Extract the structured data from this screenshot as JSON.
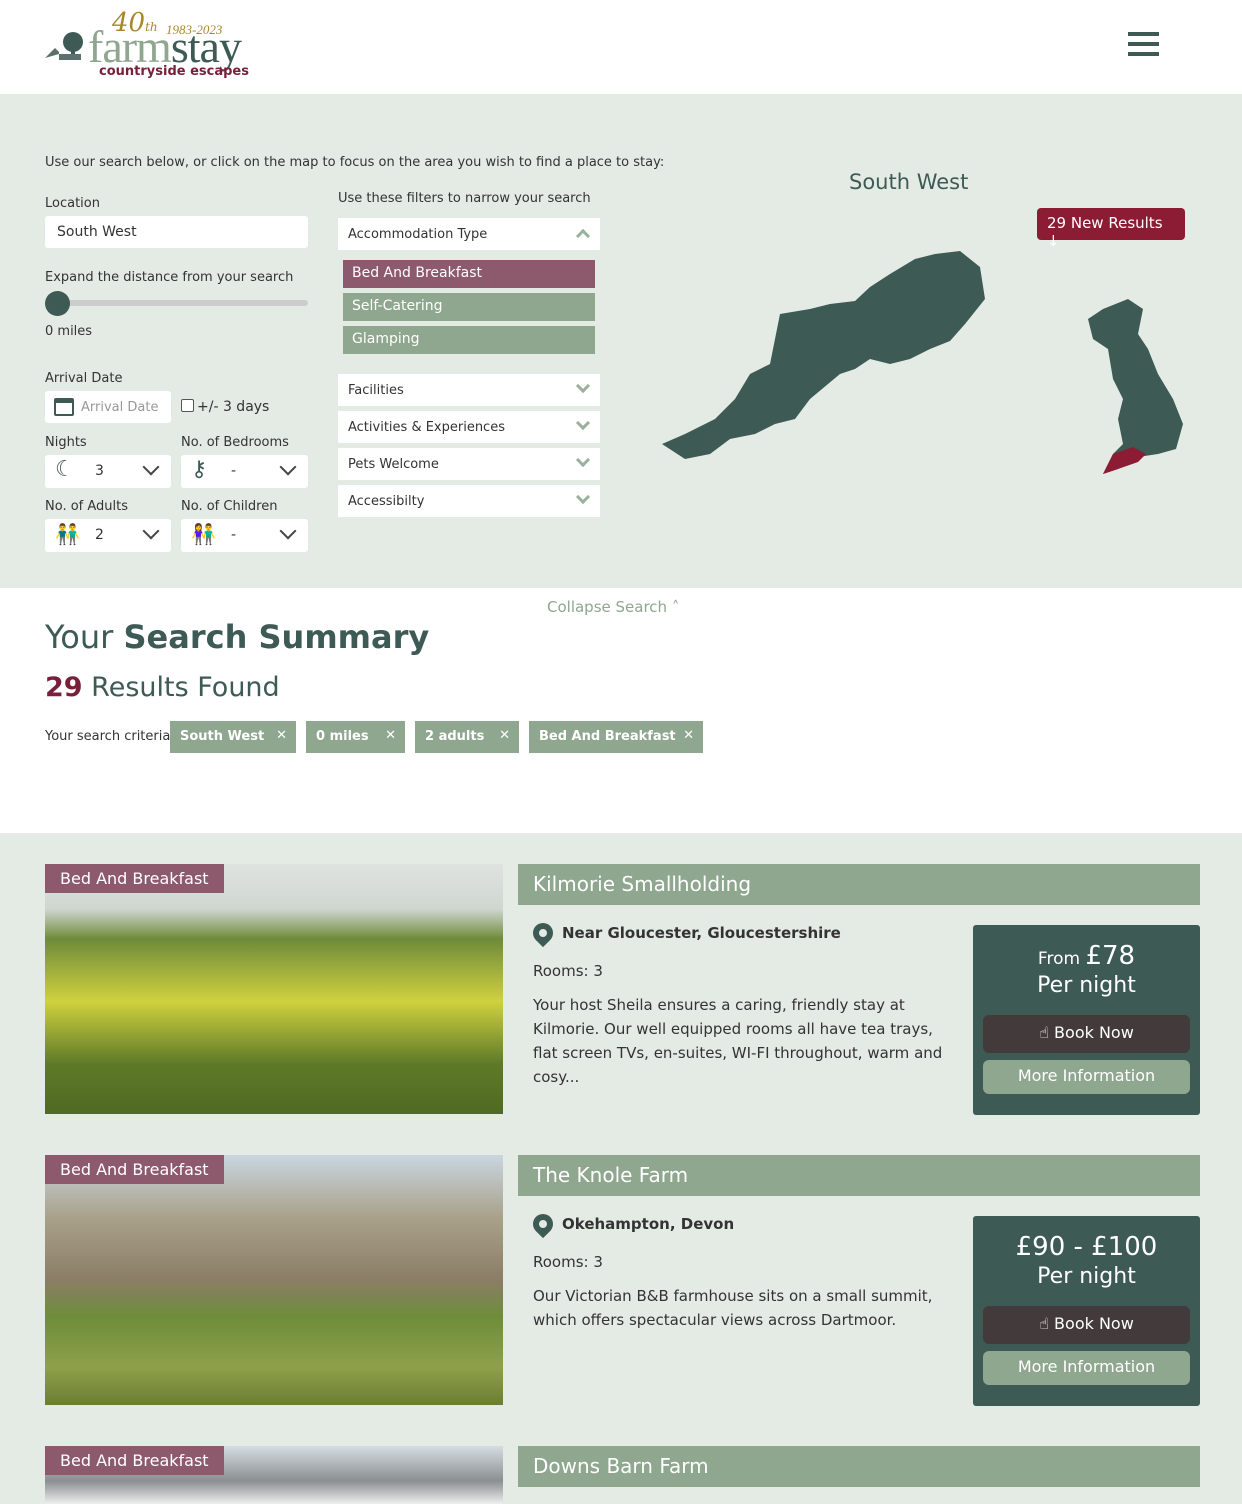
{
  "header": {
    "logo": {
      "anniv": "40",
      "anniv_suffix": "th",
      "years": "1983-2023",
      "name_a": "farm",
      "name_b": "stay",
      "tagline": "countryside escapes"
    },
    "menu_icon": "hamburger-icon"
  },
  "search": {
    "intro": "Use our search below, or click on the map to focus on the area you wish to find a place to stay:",
    "location_label": "Location",
    "location_value": "South West",
    "distance_label": "Expand the distance from your search",
    "distance_value": "0 miles",
    "distance_fraction": 0,
    "arrival_label": "Arrival Date",
    "arrival_placeholder": "Arrival Date",
    "flex_label": "+/- 3 days",
    "flex_checked": false,
    "nights_label": "Nights",
    "nights_value": "3",
    "bedrooms_label": "No. of Bedrooms",
    "bedrooms_value": "-",
    "adults_label": "No. of Adults",
    "adults_value": "2",
    "children_label": "No. of Children",
    "children_value": "-",
    "filters_label": "Use these filters to narrow your search",
    "accommodation_label": "Accommodation Type",
    "accommodation_options": [
      "Bed And Breakfast",
      "Self-Catering",
      "Glamping"
    ],
    "selected_option": "Bed And Breakfast",
    "filters": [
      "Facilities",
      "Activities & Experiences",
      "Pets Welcome",
      "Accessibilty"
    ],
    "new_results": "29 New Results ↓",
    "map_title": "South West",
    "collapse": "Collapse Search"
  },
  "summary": {
    "title_a": "Your ",
    "title_b": "Search Summary",
    "count": "29",
    "count_label": " Results Found",
    "criteria_label": "Your search criteria:",
    "criteria": [
      "South West",
      "0 miles",
      "2 adults",
      "Bed And Breakfast"
    ]
  },
  "colors": {
    "primary": "#3d5a55",
    "accent": "#8c1b34",
    "sage": "#8fa68f",
    "bg": "#e4ebe5"
  },
  "results": [
    {
      "type": "Bed And Breakfast",
      "name": "Kilmorie Smallholding",
      "location": "Near Gloucester, Gloucestershire",
      "rooms": "Rooms: 3",
      "desc": "Your host Sheila ensures a caring, friendly stay at Kilmorie. Our well equipped rooms all have tea trays, flat screen TVs, en-suites, WI-FI throughout, warm and cosy...",
      "price_prefix": "From ",
      "price": "£78",
      "per": "Per night",
      "book": "Book Now",
      "more": "More Information"
    },
    {
      "type": "Bed And Breakfast",
      "name": "The Knole Farm",
      "location": "Okehampton, Devon",
      "rooms": "Rooms: 3",
      "desc": "Our Victorian B&B farmhouse sits on a small summit, which offers spectacular views across Dartmoor.",
      "price_prefix": "",
      "price": "£90 - £100",
      "per": "Per night",
      "book": "Book Now",
      "more": "More Information"
    },
    {
      "type": "Bed And Breakfast",
      "name": "Downs Barn Farm"
    }
  ]
}
